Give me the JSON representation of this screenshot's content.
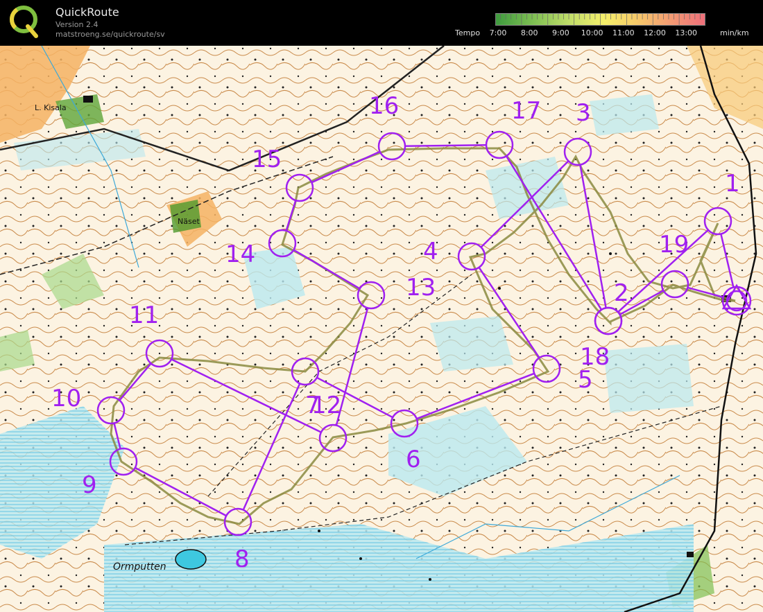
{
  "app": {
    "title": "QuickRoute",
    "version": "Version 2.4",
    "url": "matstroeng.se/quickroute/sv"
  },
  "legend": {
    "label": "Tempo",
    "ticks": [
      "7:00",
      "8:00",
      "9:00",
      "10:00",
      "11:00",
      "12:00",
      "13:00"
    ],
    "unit": "min/km",
    "colors": {
      "fast": "#3e9a3e",
      "medium": "#f5ef6a",
      "slow": "#ee6f7a"
    }
  },
  "map": {
    "place_names": {
      "kisala": "L. Kisala",
      "naset": "Näset",
      "ormputten": "Ormputten"
    },
    "course_color": "#a020f0",
    "route_color": "#8a8a40",
    "controls": [
      {
        "id": "start",
        "label": ""
      },
      {
        "id": "c1",
        "label": "1"
      },
      {
        "id": "c2",
        "label": "2"
      },
      {
        "id": "c3",
        "label": "3"
      },
      {
        "id": "c4",
        "label": "4"
      },
      {
        "id": "c5",
        "label": "5"
      },
      {
        "id": "c6",
        "label": "6"
      },
      {
        "id": "c7",
        "label": "7"
      },
      {
        "id": "c8",
        "label": "8"
      },
      {
        "id": "c9",
        "label": "9"
      },
      {
        "id": "c10",
        "label": "10"
      },
      {
        "id": "c11",
        "label": "11"
      },
      {
        "id": "c12",
        "label": "12"
      },
      {
        "id": "c13",
        "label": "13"
      },
      {
        "id": "c14",
        "label": "14"
      },
      {
        "id": "c15",
        "label": "15"
      },
      {
        "id": "c16",
        "label": "16"
      },
      {
        "id": "c17",
        "label": "17"
      },
      {
        "id": "c18",
        "label": "18"
      },
      {
        "id": "c19",
        "label": "19"
      }
    ]
  }
}
